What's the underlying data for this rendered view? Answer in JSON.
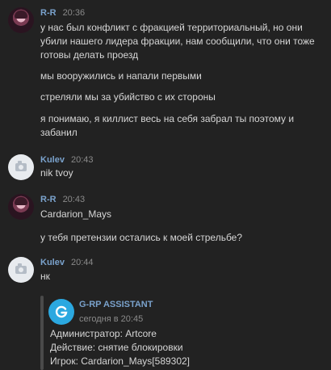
{
  "messages": [
    {
      "author": "R-R",
      "time": "20:36",
      "lines": [
        "у нас был конфликт с фракцией территориальный, но они",
        "убили нашего лидера фракции, нам сообщили, что они тоже",
        "готовы делать проезд",
        "мы вооружились и напали первыми",
        "стреляли мы за убийство с их стороны",
        "я понимаю, я киллист весь на себя забрал ты поэтому и",
        "забанил"
      ]
    },
    {
      "author": "Kulev",
      "time": "20:43",
      "lines": [
        "nik tvoy"
      ]
    },
    {
      "author": "R-R",
      "time": "20:43",
      "lines": [
        "Cardarion_Mays",
        "у тебя претензии остались к моей стрельбе?"
      ]
    },
    {
      "author": "Kulev",
      "time": "20:44",
      "lines": [
        "нк"
      ]
    }
  ],
  "embed": {
    "title": "G-RP ASSISTANT",
    "subtitle": "сегодня в 20:45",
    "lines": [
      "Администратор: Artcore",
      "Действие: снятие блокировки",
      "Игрок: Cardarion_Mays[589302]"
    ]
  },
  "colors": {
    "background": "#222222",
    "author": "#7aa2cc",
    "text": "#d6d6d6",
    "muted": "#8a8a8a",
    "embed_logo": "#2ba8e0"
  },
  "icons": {
    "rr_avatar": "user-avatar",
    "kulev_avatar": "camera-icon",
    "embed_logo": "g-logo-icon"
  }
}
